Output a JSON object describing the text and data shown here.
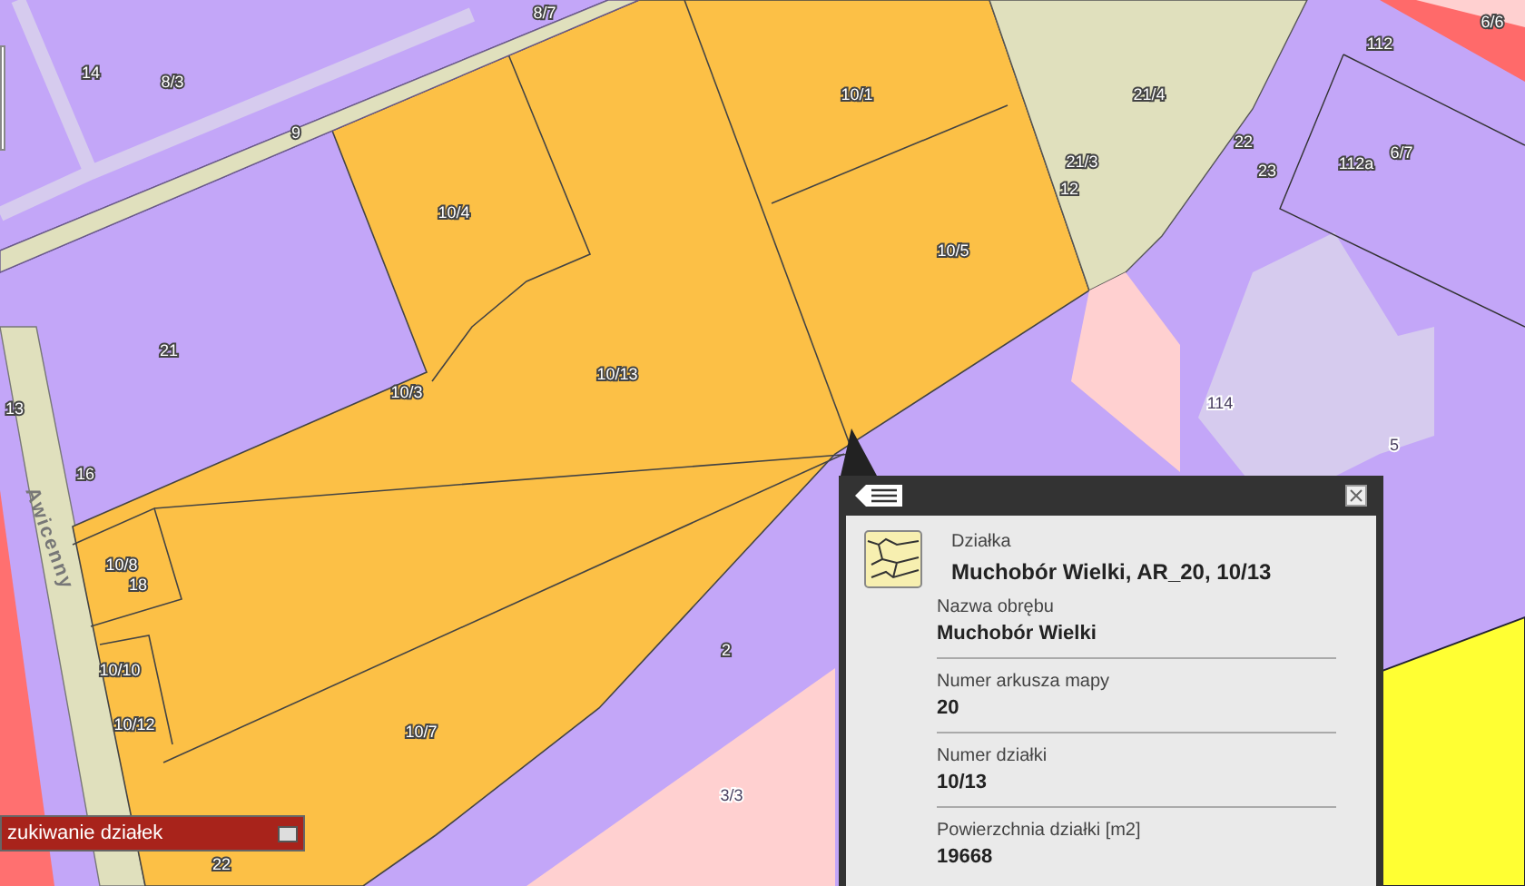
{
  "map": {
    "labels": [
      "14",
      "8/3",
      "8/7",
      "9",
      "10/1",
      "21/4",
      "22",
      "112",
      "6/6",
      "112a",
      "6/7",
      "23",
      "21/3",
      "12",
      "10/4",
      "10/5",
      "21",
      "10/3",
      "10/13",
      "114",
      "5",
      "13",
      "16",
      "10/8",
      "18",
      "10/10",
      "10/12",
      "2",
      "10/7",
      "3/3",
      "22"
    ],
    "street_label": "Awicenny"
  },
  "popup": {
    "feature_type": "Działka",
    "title": "Muchobór Wielki, AR_20, 10/13",
    "fields": [
      {
        "label": "Nazwa obrębu",
        "value": "Muchobór Wielki"
      },
      {
        "label": "Numer arkusza mapy",
        "value": "20"
      },
      {
        "label": "Numer działki",
        "value": "10/13"
      },
      {
        "label": "Powierzchnia działki [m2]",
        "value": "19668"
      }
    ]
  },
  "panel_bar": {
    "title": "zukiwanie działek"
  }
}
